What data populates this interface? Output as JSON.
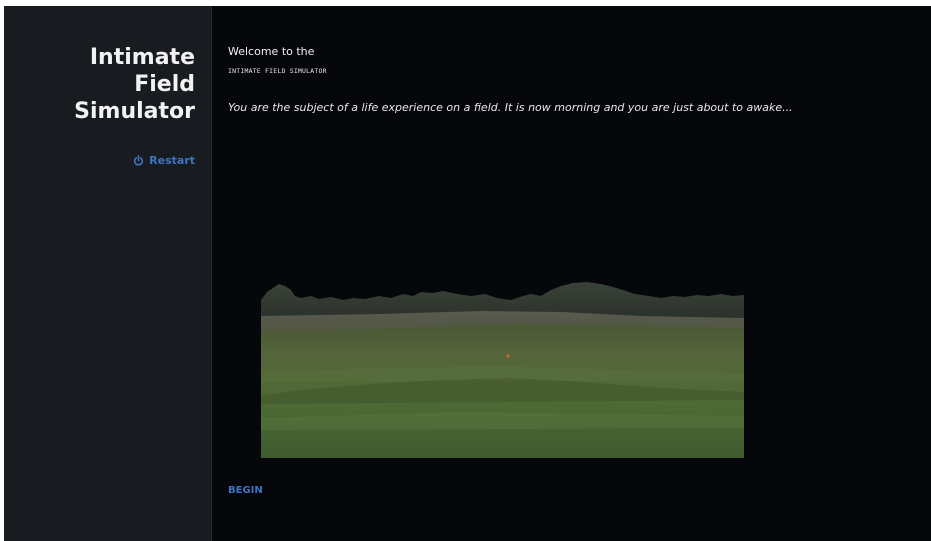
{
  "sidebar": {
    "story_title_line1": "Intimate",
    "story_title_line2": "Field",
    "story_title_line3": "Simulator",
    "restart_label": "Restart",
    "restart_icon": "power-icon"
  },
  "main": {
    "welcome_text": "Welcome to the",
    "subtitle_text": "INTIMATE FIELD SIMULATOR",
    "intro_text": "You are the subject of a life experience on a field. It is now morning and you are just about to awake...",
    "begin_label": "BEGIN"
  },
  "colors": {
    "page_background": "#05070b",
    "sidebar_background": "#181b1f",
    "link_accent": "#3f73c4",
    "text": "#f0f0f0"
  }
}
